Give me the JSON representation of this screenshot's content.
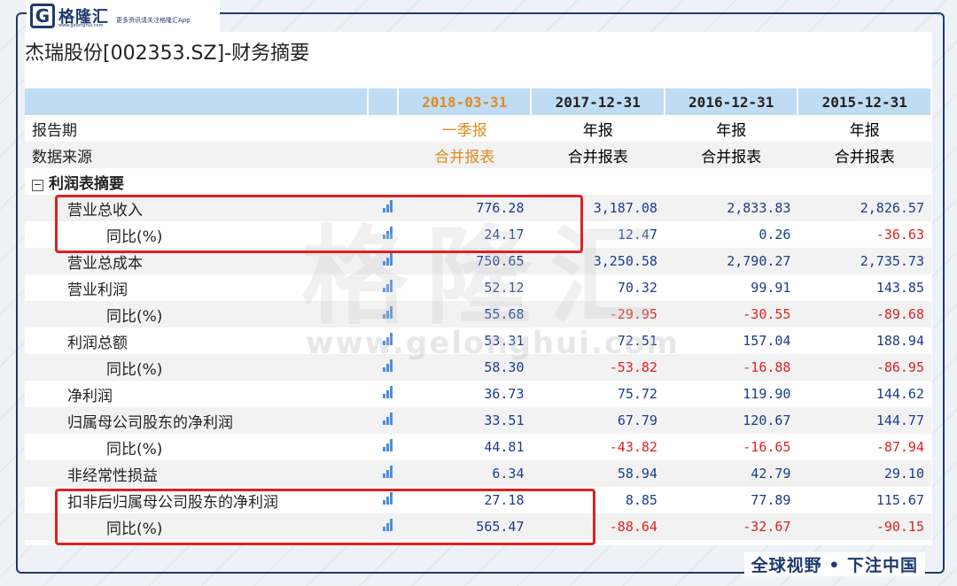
{
  "brand": {
    "name": "格隆汇",
    "logo_letter": "G",
    "logo_url": "www.gelonghui.com",
    "tagline": "更多资讯请关注格隆汇App",
    "slogan": "全球视野 • 下注中国",
    "watermark": "格隆汇",
    "watermark_url": "www.gelonghui.com"
  },
  "page_title": "杰瑞股份[002353.SZ]-财务摘要",
  "columns": [
    "2018-03-31",
    "2017-12-31",
    "2016-12-31",
    "2015-12-31"
  ],
  "report_period": {
    "label": "报告期",
    "values": [
      "一季报",
      "年报",
      "年报",
      "年报"
    ]
  },
  "data_source": {
    "label": "数据来源",
    "values": [
      "合并报表",
      "合并报表",
      "合并报表",
      "合并报表"
    ]
  },
  "section": {
    "collapse_symbol": "⊟",
    "title": "利润表摘要"
  },
  "rows": [
    {
      "label": "营业总收入",
      "values": [
        "776.28",
        "3,187.08",
        "2,833.83",
        "2,826.57"
      ]
    },
    {
      "label": "同比(%)",
      "values": [
        "24.17",
        "12.47",
        "0.26",
        "-36.63"
      ]
    },
    {
      "label": "营业总成本",
      "values": [
        "750.65",
        "3,250.58",
        "2,790.27",
        "2,735.73"
      ]
    },
    {
      "label": "营业利润",
      "values": [
        "52.12",
        "70.32",
        "99.91",
        "143.85"
      ]
    },
    {
      "label": "同比(%)",
      "values": [
        "55.68",
        "-29.95",
        "-30.55",
        "-89.68"
      ]
    },
    {
      "label": "利润总额",
      "values": [
        "53.31",
        "72.51",
        "157.04",
        "188.94"
      ]
    },
    {
      "label": "同比(%)",
      "values": [
        "58.30",
        "-53.82",
        "-16.88",
        "-86.95"
      ]
    },
    {
      "label": "净利润",
      "values": [
        "36.73",
        "75.72",
        "119.90",
        "144.62"
      ]
    },
    {
      "label": "归属母公司股东的净利润",
      "values": [
        "33.51",
        "67.79",
        "120.67",
        "144.77"
      ]
    },
    {
      "label": "同比(%)",
      "values": [
        "44.81",
        "-43.82",
        "-16.65",
        "-87.94"
      ]
    },
    {
      "label": "非经常性损益",
      "values": [
        "6.34",
        "58.94",
        "42.79",
        "29.10"
      ]
    },
    {
      "label": "扣非后归属母公司股东的净利润",
      "values": [
        "27.18",
        "8.85",
        "77.89",
        "115.67"
      ]
    },
    {
      "label": "同比(%)",
      "values": [
        "565.47",
        "-88.64",
        "-32.67",
        "-90.15"
      ]
    }
  ],
  "colors": {
    "header_bg": "#bfdcf5",
    "current_period": "#e08a1e",
    "positive": "#1a3c8c",
    "negative": "#e02020",
    "highlight": "#e02020",
    "brand": "#1f3a6e"
  }
}
